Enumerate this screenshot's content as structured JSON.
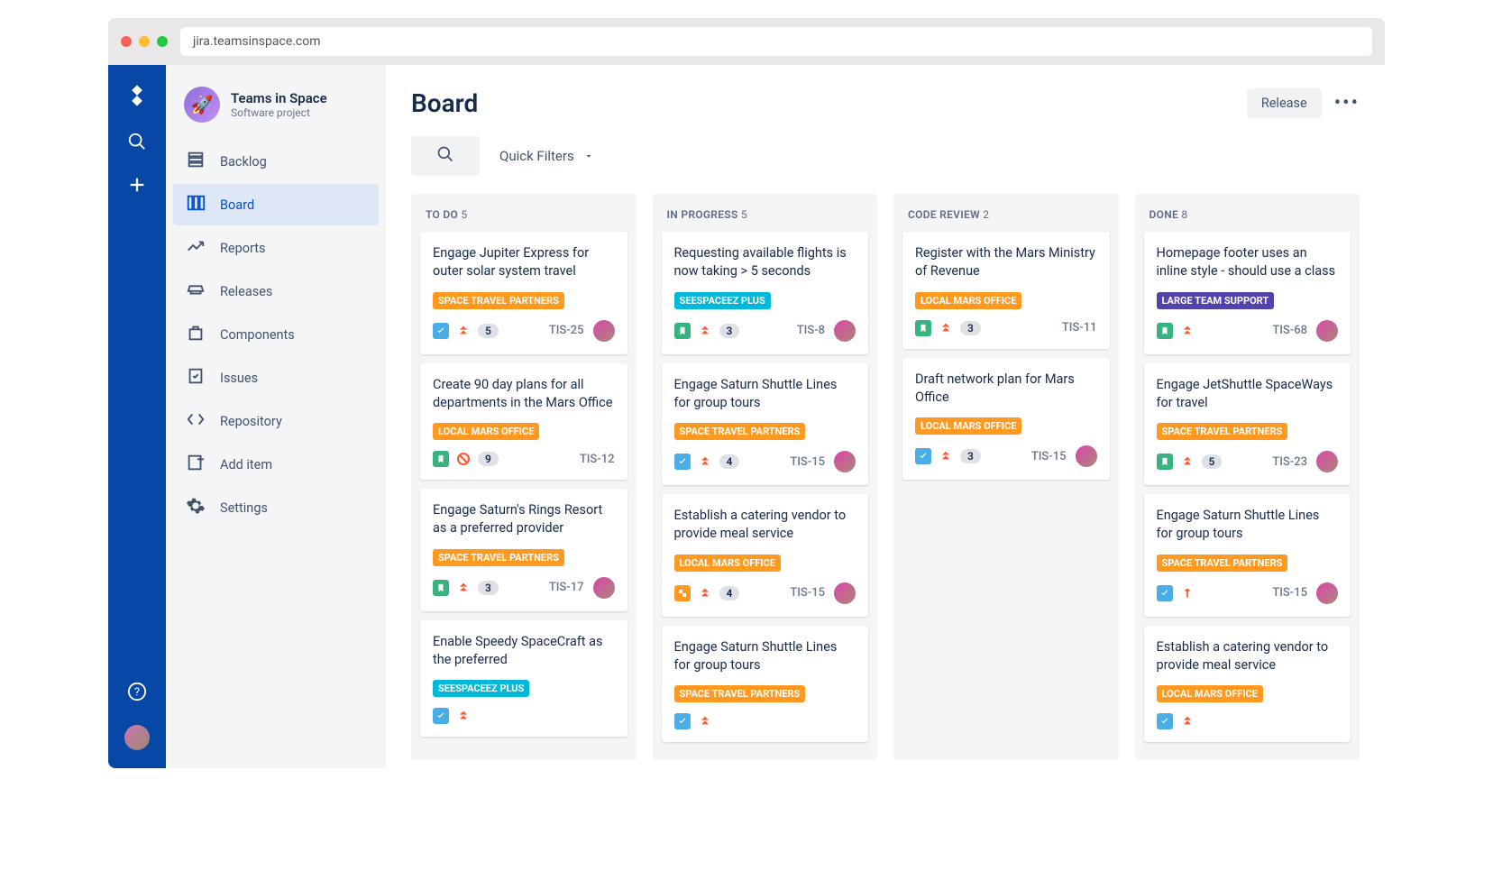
{
  "browser": {
    "url": "jira.teamsinspace.com"
  },
  "project": {
    "name": "Teams in Space",
    "type": "Software project"
  },
  "nav": {
    "items": [
      {
        "label": "Backlog"
      },
      {
        "label": "Board"
      },
      {
        "label": "Reports"
      },
      {
        "label": "Releases"
      },
      {
        "label": "Components"
      },
      {
        "label": "Issues"
      },
      {
        "label": "Repository"
      },
      {
        "label": "Add item"
      },
      {
        "label": "Settings"
      }
    ],
    "activeIndex": 1
  },
  "header": {
    "title": "Board",
    "releaseLabel": "Release",
    "quickFiltersLabel": "Quick Filters"
  },
  "labels": {
    "spaceTravelPartners": "SPACE TRAVEL PARTNERS",
    "seespaceezPlus": "SEESPACEEZ PLUS",
    "localMarsOffice": "LOCAL MARS OFFICE",
    "largeTeamSupport": "LARGE TEAM SUPPORT"
  },
  "columns": [
    {
      "name": "TO DO",
      "count": "5",
      "cards": [
        {
          "title": "Engage Jupiter Express for outer solar system travel",
          "label": "spaceTravelPartners",
          "labelStyle": "lbl-orange",
          "type": "task",
          "priority": "highest",
          "points": "5",
          "key": "TIS-25",
          "hasAvatar": true
        },
        {
          "title": "Create 90 day plans for all departments in the Mars Office",
          "label": "localMarsOffice",
          "labelStyle": "lbl-orange",
          "type": "story",
          "priority": "blocker",
          "points": "9",
          "key": "TIS-12",
          "hasAvatar": false
        },
        {
          "title": "Engage Saturn's Rings Resort as a preferred provider",
          "label": "spaceTravelPartners",
          "labelStyle": "lbl-orange",
          "type": "story",
          "priority": "highest",
          "points": "3",
          "key": "TIS-17",
          "hasAvatar": true
        },
        {
          "title": "Enable Speedy SpaceCraft as the preferred",
          "label": "seespaceezPlus",
          "labelStyle": "lbl-teal",
          "type": "task",
          "priority": "highest",
          "points": "",
          "key": "",
          "hasAvatar": false
        }
      ]
    },
    {
      "name": "IN PROGRESS",
      "count": "5",
      "cards": [
        {
          "title": "Requesting available flights is now taking > 5 seconds",
          "label": "seespaceezPlus",
          "labelStyle": "lbl-teal",
          "type": "story",
          "priority": "highest",
          "points": "3",
          "key": "TIS-8",
          "hasAvatar": true
        },
        {
          "title": "Engage Saturn Shuttle Lines for group tours",
          "label": "spaceTravelPartners",
          "labelStyle": "lbl-orange",
          "type": "task",
          "priority": "highest",
          "points": "4",
          "key": "TIS-15",
          "hasAvatar": true
        },
        {
          "title": "Establish a catering vendor to provide meal service",
          "label": "localMarsOffice",
          "labelStyle": "lbl-orange",
          "type": "sub",
          "priority": "highest",
          "points": "4",
          "key": "TIS-15",
          "hasAvatar": true
        },
        {
          "title": "Engage Saturn Shuttle Lines for group tours",
          "label": "spaceTravelPartners",
          "labelStyle": "lbl-orange",
          "type": "task",
          "priority": "highest",
          "points": "",
          "key": "",
          "hasAvatar": false
        }
      ]
    },
    {
      "name": "CODE REVIEW",
      "count": "2",
      "cards": [
        {
          "title": "Register with the Mars Ministry of Revenue",
          "label": "localMarsOffice",
          "labelStyle": "lbl-orange",
          "type": "story",
          "priority": "highest",
          "points": "3",
          "key": "TIS-11",
          "hasAvatar": false
        },
        {
          "title": "Draft network plan for Mars Office",
          "label": "localMarsOffice",
          "labelStyle": "lbl-orange",
          "type": "task",
          "priority": "highest",
          "points": "3",
          "key": "TIS-15",
          "hasAvatar": true
        }
      ]
    },
    {
      "name": "DONE",
      "count": "8",
      "cards": [
        {
          "title": "Homepage footer uses an inline style - should use a class",
          "label": "largeTeamSupport",
          "labelStyle": "lbl-purple",
          "type": "story",
          "priority": "highest",
          "points": "",
          "key": "TIS-68",
          "hasAvatar": true
        },
        {
          "title": "Engage JetShuttle SpaceWays for travel",
          "label": "spaceTravelPartners",
          "labelStyle": "lbl-orange",
          "type": "story",
          "priority": "highest",
          "points": "5",
          "key": "TIS-23",
          "hasAvatar": true
        },
        {
          "title": "Engage Saturn Shuttle Lines for group tours",
          "label": "spaceTravelPartners",
          "labelStyle": "lbl-orange",
          "type": "task",
          "priority": "high",
          "points": "",
          "key": "TIS-15",
          "hasAvatar": true
        },
        {
          "title": "Establish a catering vendor to provide meal service",
          "label": "localMarsOffice",
          "labelStyle": "lbl-orange",
          "type": "task",
          "priority": "highest",
          "points": "",
          "key": "",
          "hasAvatar": false
        }
      ]
    }
  ]
}
